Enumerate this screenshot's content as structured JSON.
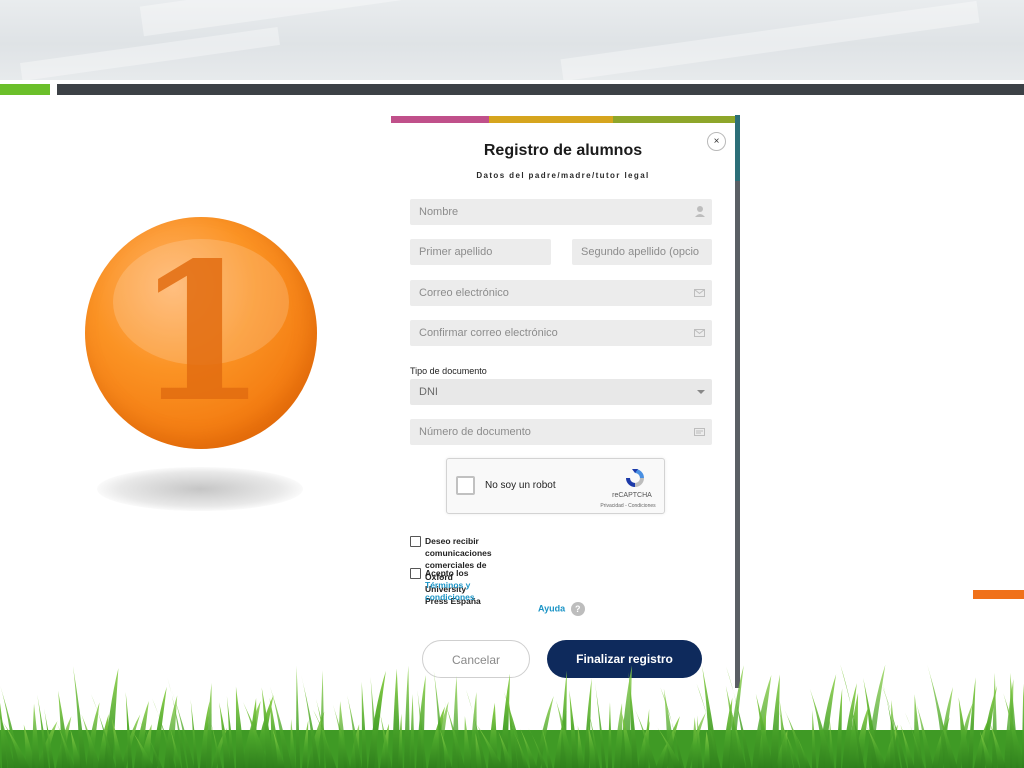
{
  "slide": {
    "step_number": "1",
    "colors": {
      "accent_green": "#6bbf2a",
      "bar_dark": "#3c4146",
      "accent_orange": "#f0711a",
      "coin_orange": "#fb9324",
      "grass_green": "#4aa52a"
    }
  },
  "form": {
    "title": "Registro de alumnos",
    "subtitle": "Datos del padre/madre/tutor legal",
    "close_symbol": "×",
    "fields": {
      "nombre": {
        "placeholder": "Nombre",
        "icon": "user-icon"
      },
      "primer_apellido": {
        "placeholder": "Primer apellido"
      },
      "segundo_apellido": {
        "placeholder": "Segundo apellido (opcio"
      },
      "correo": {
        "placeholder": "Correo electrónico",
        "icon": "envelope-icon"
      },
      "confirmar_correo": {
        "placeholder": "Confirmar correo electrónico",
        "icon": "envelope-icon"
      },
      "tipo_documento": {
        "label": "Tipo de documento",
        "value": "DNI"
      },
      "numero_documento": {
        "placeholder": "Número de documento",
        "icon": "id-card-icon"
      }
    },
    "recaptcha": {
      "label": "No soy un robot",
      "brand": "reCAPTCHA",
      "links": "Privacidad - Condiciones"
    },
    "checkboxes": {
      "comunicaciones_line1": "Deseo recibir comunicaciones comerciales de Oxford",
      "comunicaciones_line2": "University Press España",
      "acepto_prefix": "Acepto los ",
      "acepto_link": "Términos y condiciones"
    },
    "help": {
      "label": "Ayuda",
      "icon_text": "?"
    },
    "buttons": {
      "cancel": "Cancelar",
      "submit": "Finalizar registro"
    },
    "colors": {
      "primary_button": "#0e2a5c",
      "link": "#1b94c6",
      "stripe_pink": "#c0508a",
      "stripe_yellow": "#d6a51e",
      "stripe_green": "#8ea62a"
    }
  }
}
